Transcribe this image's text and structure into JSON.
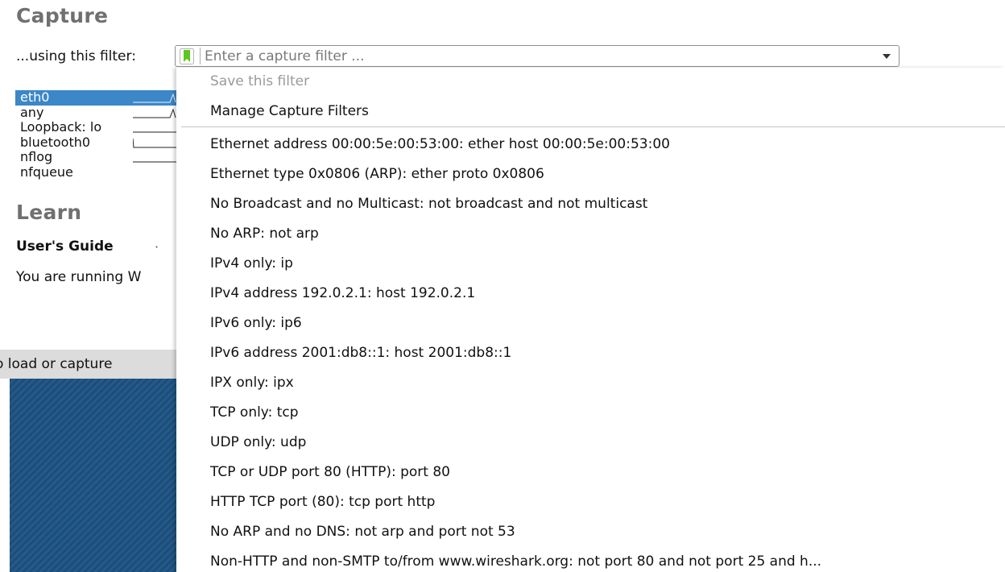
{
  "capture": {
    "title": "Capture",
    "filter_label": "...using this filter:",
    "filter_placeholder": "Enter a capture filter ...",
    "interfaces": [
      {
        "name": "eth0",
        "selected": true
      },
      {
        "name": "any"
      },
      {
        "name": "Loopback: lo"
      },
      {
        "name": "bluetooth0"
      },
      {
        "name": "nflog"
      },
      {
        "name": "nfqueue"
      }
    ]
  },
  "learn": {
    "title": "Learn",
    "users_guide": "User's Guide",
    "separator": "·",
    "running_text": "You are running W"
  },
  "statusbar": {
    "text": "o load or capture"
  },
  "filter_menu": {
    "save_filter": "Save this filter",
    "manage_filters": "Manage Capture Filters",
    "items": [
      "Ethernet address 00:00:5e:00:53:00: ether host 00:00:5e:00:53:00",
      "Ethernet type 0x0806 (ARP): ether proto 0x0806",
      "No Broadcast and no Multicast: not broadcast and not multicast",
      "No ARP: not arp",
      "IPv4 only: ip",
      "IPv4 address 192.0.2.1: host 192.0.2.1",
      "IPv6 only: ip6",
      "IPv6 address 2001:db8::1: host 2001:db8::1",
      "IPX only: ipx",
      "TCP only: tcp",
      "UDP only: udp",
      "TCP or UDP port 80 (HTTP): port 80",
      "HTTP TCP port (80): tcp port http",
      "No ARP and no DNS: not arp and port not 53",
      "Non-HTTP and non-SMTP to/from www.wireshark.org: not port 80 and not port 25 and h..."
    ]
  },
  "colors": {
    "accent": "#3b87c8",
    "bookmark": "#5cc71f",
    "title_gray": "#707070"
  }
}
